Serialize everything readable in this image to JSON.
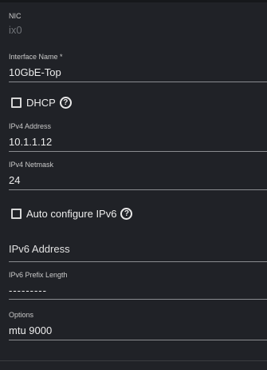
{
  "nic": {
    "label": "NIC",
    "value": "ix0"
  },
  "interface_name": {
    "label": "Interface Name *",
    "value": "10GbE-Top"
  },
  "dhcp": {
    "label": "DHCP",
    "checked": false,
    "help_icon": "help-circle-icon"
  },
  "ipv4_address": {
    "label": "IPv4 Address",
    "value": "10.1.1.12"
  },
  "ipv4_netmask": {
    "label": "IPv4 Netmask",
    "value": "24"
  },
  "auto_ipv6": {
    "label": "Auto configure IPv6",
    "checked": false,
    "help_icon": "help-circle-icon"
  },
  "ipv6_address": {
    "placeholder": "IPv6 Address"
  },
  "ipv6_prefix": {
    "label": "IPv6 Prefix Length",
    "value": "---------"
  },
  "options": {
    "label": "Options",
    "value": "mtu 9000"
  },
  "colors": {
    "background": "#202227",
    "text": "#ececec",
    "underline": "#8a8c90",
    "disabled_text": "#6f7277"
  }
}
